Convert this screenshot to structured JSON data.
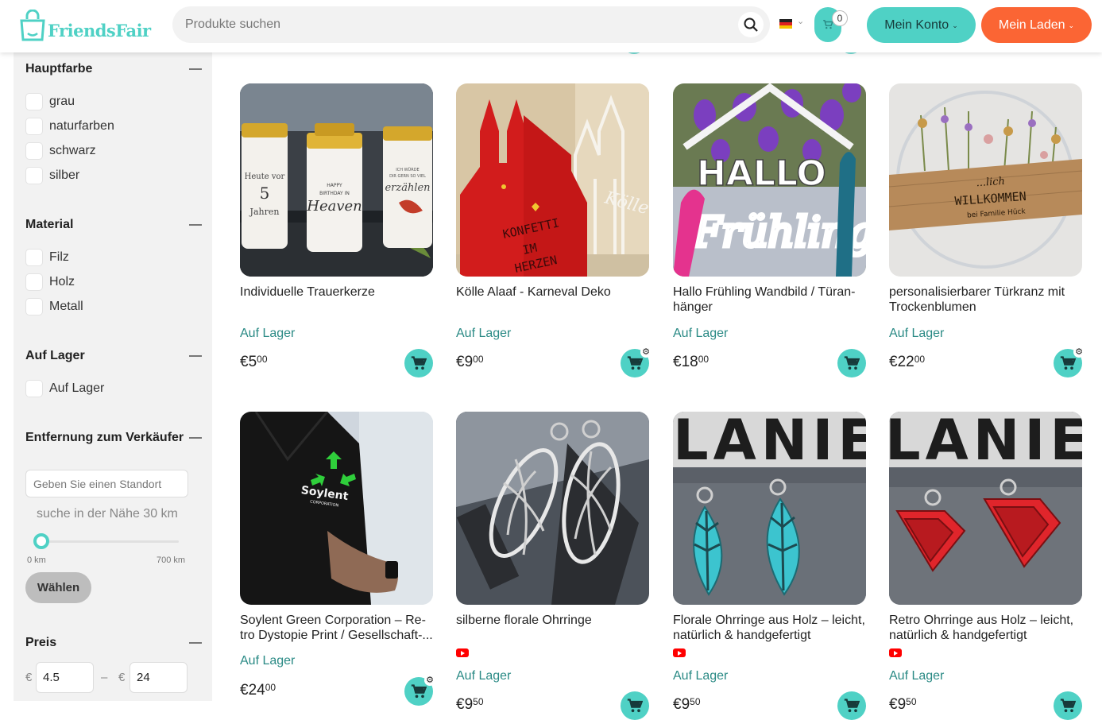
{
  "brand": {
    "name": "FriendsFair",
    "accent": "#4fd1c5",
    "orange": "#fb6534"
  },
  "header": {
    "search_placeholder": "Produkte suchen",
    "cart_count": "0",
    "account_label": "Mein Konto",
    "store_label": "Mein Laden"
  },
  "filters": {
    "color": {
      "title": "Hauptfarbe",
      "options": [
        "grau",
        "naturfarben",
        "schwarz",
        "silber"
      ]
    },
    "material": {
      "title": "Material",
      "options": [
        "Filz",
        "Holz",
        "Metall"
      ]
    },
    "stock": {
      "title": "Auf Lager",
      "options": [
        "Auf Lager"
      ]
    },
    "distance": {
      "title": "Entfernung zum Verkäufer",
      "placeholder": "Geben Sie einen Standort",
      "near_text": "suche in der Nähe 30 km",
      "min_label": "0 km",
      "max_label": "700 km",
      "value_km": 30,
      "button": "Wählen"
    },
    "price": {
      "title": "Preis",
      "currency": "€",
      "min": "4.5",
      "max": "24",
      "dash": "–"
    }
  },
  "products": [
    {
      "title": "Individuelle Trauerkerze",
      "stock": "Auf Lager",
      "price_main": "€5",
      "price_cents": "00",
      "youtube": false,
      "settings": false
    },
    {
      "title": "Kölle Alaaf - Karneval Deko",
      "stock": "Auf Lager",
      "price_main": "€9",
      "price_cents": "00",
      "youtube": false,
      "settings": true
    },
    {
      "title": "Hallo Frühling Wandbild / Türan-hänger",
      "stock": "Auf Lager",
      "price_main": "€18",
      "price_cents": "00",
      "youtube": false,
      "settings": false
    },
    {
      "title": "personalisierbarer Türkranz mit Trockenblumen",
      "stock": "Auf Lager",
      "price_main": "€22",
      "price_cents": "00",
      "youtube": false,
      "settings": true
    },
    {
      "title": "Soylent Green Corporation – Re-tro Dystopie Print / Gesellschaft-...",
      "stock": "Auf Lager",
      "price_main": "€24",
      "price_cents": "00",
      "youtube": false,
      "settings": true
    },
    {
      "title": "silberne florale Ohrringe",
      "stock": "Auf Lager",
      "price_main": "€9",
      "price_cents": "50",
      "youtube": true,
      "settings": false
    },
    {
      "title": "Florale Ohrringe aus Holz – leicht, natürlich & handgefertigt",
      "stock": "Auf Lager",
      "price_main": "€9",
      "price_cents": "50",
      "youtube": true,
      "settings": false
    },
    {
      "title": "Retro Ohrringe aus Holz – leicht, natürlich & handgefertigt",
      "stock": "Auf Lager",
      "price_main": "€9",
      "price_cents": "50",
      "youtube": true,
      "settings": false
    }
  ],
  "image_text": {
    "candle_1": "Heute vor 5 Jahren",
    "candle_2": "HAPPY BIRTHDAY IN Heaven",
    "candle_3": "Ich würde dir gern so viel erzählen",
    "koeln": "KONFETTI IM HERZEN",
    "koeln_back": "Kölle",
    "hallo": "HALLO",
    "fruehling": "Frühling",
    "wreath_1": "...lich",
    "wreath_2": "WILLKOMMEN",
    "wreath_3": "bei Familie Hück",
    "shirt_1": "Soylent",
    "shirt_2": "CORPORATION",
    "letters": "LANIE"
  }
}
